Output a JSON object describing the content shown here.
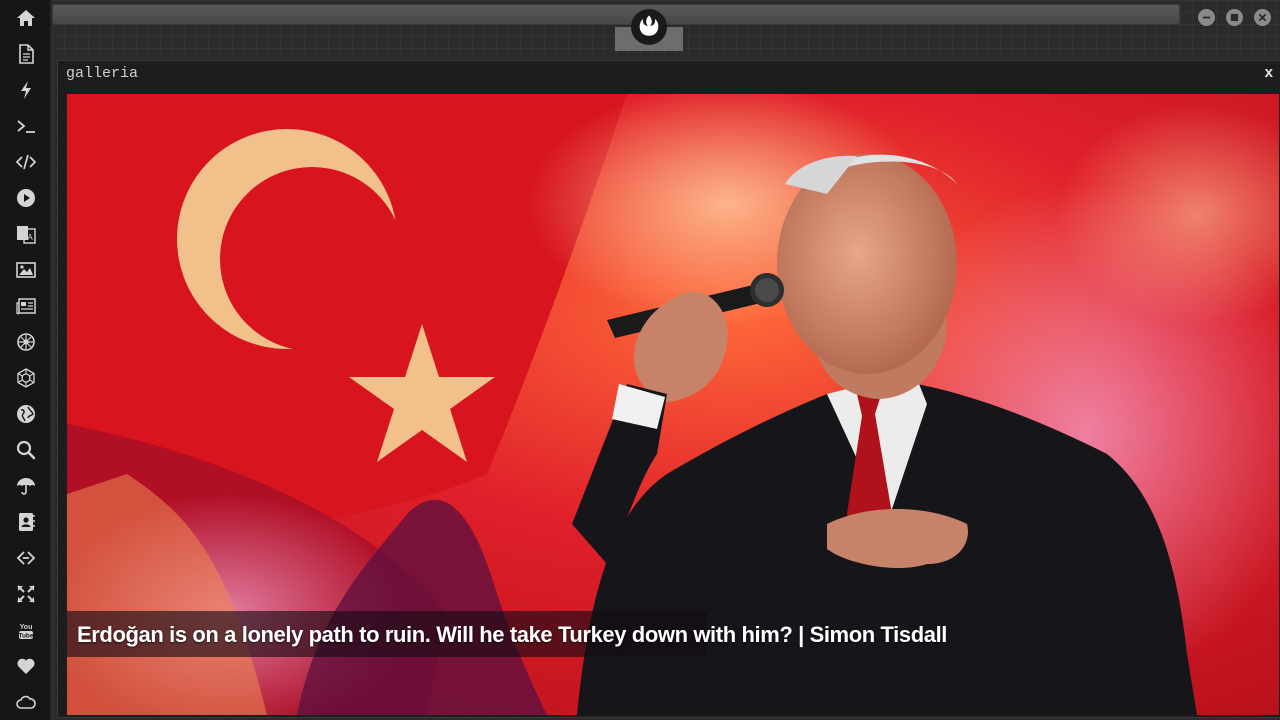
{
  "window": {
    "title": "galleria",
    "close_label": "x"
  },
  "gallery": {
    "caption": "Erdoğan is on a lonely path to ruin. Will he take Turkey down with him? | Simon Tisdall"
  },
  "sidebar": {
    "items": [
      {
        "icon": "home-icon"
      },
      {
        "icon": "document-icon"
      },
      {
        "icon": "lightning-icon"
      },
      {
        "icon": "terminal-icon"
      },
      {
        "icon": "code-icon"
      },
      {
        "icon": "play-icon"
      },
      {
        "icon": "translate-icon"
      },
      {
        "icon": "image-icon"
      },
      {
        "icon": "newspaper-icon"
      },
      {
        "icon": "jedi-order-icon"
      },
      {
        "icon": "empire-icon"
      },
      {
        "icon": "globe-icon"
      },
      {
        "icon": "search-icon"
      },
      {
        "icon": "umbrella-icon"
      },
      {
        "icon": "contact-book-icon"
      },
      {
        "icon": "connection-icon"
      },
      {
        "icon": "expand-icon"
      },
      {
        "icon": "youtube-icon"
      },
      {
        "icon": "heart-icon"
      },
      {
        "icon": "cloud-icon"
      }
    ]
  },
  "top_bar": {
    "logo_icon": "rebel-alliance-icon",
    "controls": [
      "minimize-icon",
      "maximize-icon",
      "close-icon"
    ]
  },
  "colors": {
    "sidebar_bg": "#161616",
    "icon": "#d4d4d4",
    "caption_bg": "rgba(20,10,20,0.62)",
    "caption_text": "#ffffff"
  }
}
